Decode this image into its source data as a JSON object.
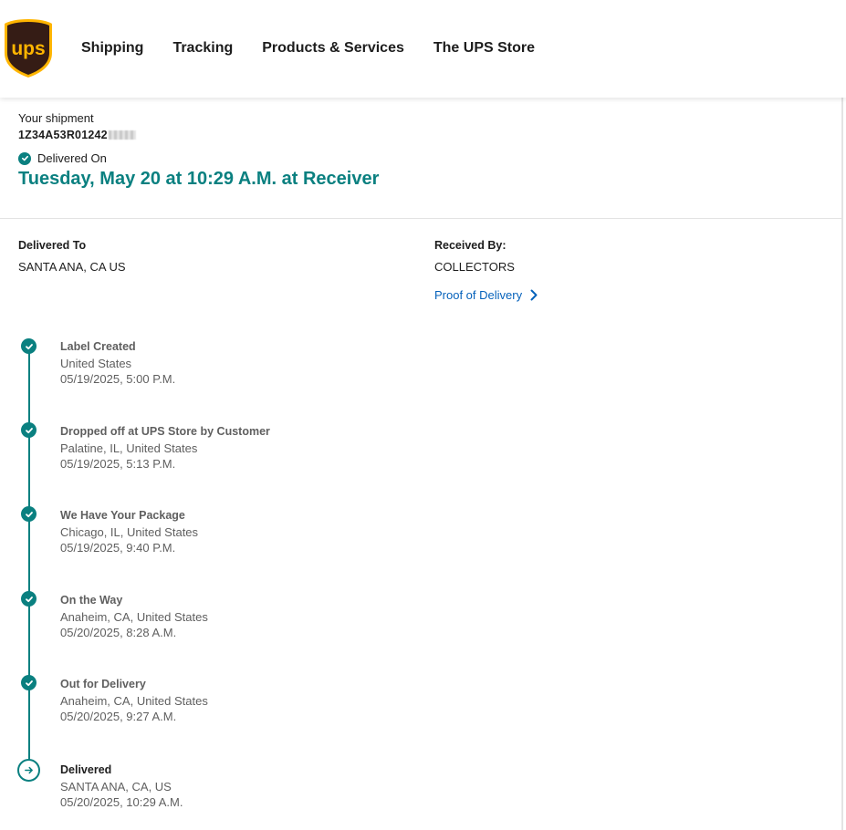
{
  "header": {
    "logo_text": "ups",
    "nav": [
      "Shipping",
      "Tracking",
      "Products & Services",
      "The UPS Store"
    ]
  },
  "summary": {
    "label": "Your shipment",
    "tracking_number": "1Z34A53R01242",
    "status": "Delivered On",
    "delivered_date": "Tuesday, May 20 at 10:29 A.M. at Receiver"
  },
  "delivery": {
    "to_label": "Delivered To",
    "to_value": "SANTA ANA, CA US",
    "received_label": "Received By:",
    "received_value": "COLLECTORS",
    "proof_link": "Proof of Delivery"
  },
  "timeline": [
    {
      "title": "Label Created",
      "location": "United States",
      "time": "05/19/2025, 5:00 P.M."
    },
    {
      "title": "Dropped off at UPS Store by Customer",
      "location": "Palatine, IL, United States",
      "time": "05/19/2025, 5:13 P.M."
    },
    {
      "title": "We Have Your Package",
      "location": "Chicago, IL, United States",
      "time": "05/19/2025, 9:40 P.M."
    },
    {
      "title": "On the Way",
      "location": "Anaheim, CA, United States",
      "time": "05/20/2025, 8:28 A.M."
    },
    {
      "title": "Out for Delivery",
      "location": "Anaheim, CA, United States",
      "time": "05/20/2025, 9:27 A.M."
    },
    {
      "title": "Delivered",
      "location": "SANTA ANA, CA, US",
      "time": "05/20/2025, 10:29 A.M."
    }
  ],
  "colors": {
    "accent": "#0a8080",
    "link": "#0662bb",
    "brand_brown": "#351c15",
    "brand_gold": "#ffb500"
  }
}
